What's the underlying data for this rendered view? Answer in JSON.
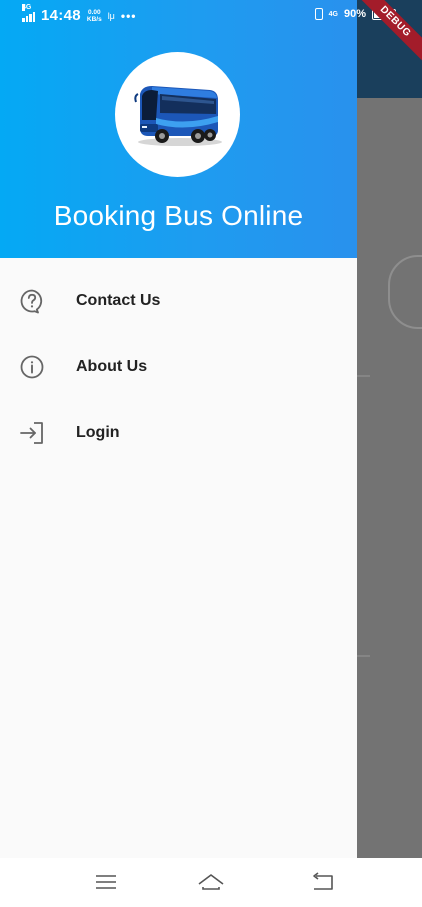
{
  "status_bar": {
    "time": "14:48",
    "network_left": "4G",
    "speed_top": "0.00",
    "speed_bottom": "KB/s",
    "extra": "Ɩμ",
    "dots": "•••",
    "network_right": "4G",
    "battery": "90%"
  },
  "debug_banner": "DEBUG",
  "drawer": {
    "app_name": "Booking Bus Online",
    "menu": [
      {
        "label": "Contact Us",
        "icon": "help-icon"
      },
      {
        "label": "About Us",
        "icon": "info-icon"
      },
      {
        "label": "Login",
        "icon": "login-icon"
      }
    ]
  },
  "nav": {
    "buttons": [
      "menu-icon",
      "home-icon",
      "back-icon"
    ]
  },
  "colors": {
    "header_start": "#04a9f4",
    "header_end": "#2991ed",
    "drawer_bg": "#fafafa",
    "scrim": "#737373",
    "debug": "#a31c2a"
  }
}
